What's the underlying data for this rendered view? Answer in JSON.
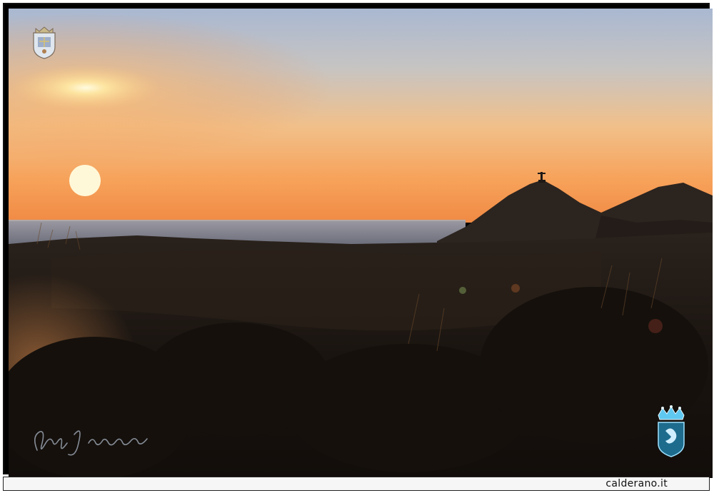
{
  "image": {
    "sky_colors": [
      "#aab9d0",
      "#c8c6c0",
      "#f0bf84",
      "#f7a057",
      "#f3843a"
    ],
    "sea_color": "#8a8fa0",
    "land_color": "#1a1410",
    "sun_color": "#fff6c8"
  },
  "watermark": {
    "site": "calderano.it"
  },
  "icons": {
    "top_crest": "coat-of-arms-icon",
    "bottom_crest": "crowned-shield-icon",
    "signature": "handwritten-signature"
  }
}
